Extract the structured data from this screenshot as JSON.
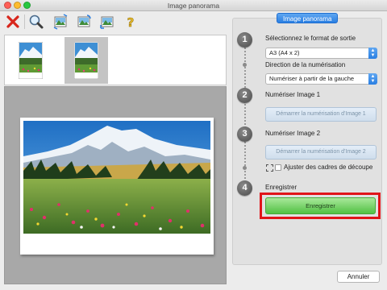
{
  "window": {
    "title": "Image panorama",
    "traffic_colors": [
      "#ff5f57",
      "#febc2e",
      "#28c840"
    ]
  },
  "toolbar": {
    "buttons": [
      {
        "icon": "delete-x-icon"
      },
      {
        "icon": "zoom-magnifier-icon"
      },
      {
        "icon": "image-swap-icon"
      },
      {
        "icon": "image-rotate-icon"
      },
      {
        "icon": "image-fit-icon"
      },
      {
        "icon": "help-question-icon"
      }
    ]
  },
  "thumbnails": [
    {
      "selected": false
    },
    {
      "selected": true
    }
  ],
  "panel": {
    "header": "Image panorama",
    "step1": {
      "number": "1",
      "label": "Sélectionnez le format de sortie",
      "format_value": "A3 (A4 x 2)",
      "direction_label": "Direction de la numérisation",
      "direction_value": "Numériser à partir de la gauche"
    },
    "step2": {
      "number": "2",
      "label": "Numériser Image 1",
      "button": "Démarrer la numérisation d'Image 1"
    },
    "step3": {
      "number": "3",
      "label": "Numériser Image 2",
      "button": "Démarrer la numérisation d'Image 2",
      "crop_label": "Ajuster des cadres de découpe"
    },
    "step4": {
      "number": "4",
      "label": "Enregistrer",
      "button": "Enregistrer"
    }
  },
  "footer": {
    "cancel": "Annuler"
  },
  "colors": {
    "accent_blue": "#2a7fe2",
    "save_green": "#51c143",
    "highlight_red": "#e01419"
  }
}
